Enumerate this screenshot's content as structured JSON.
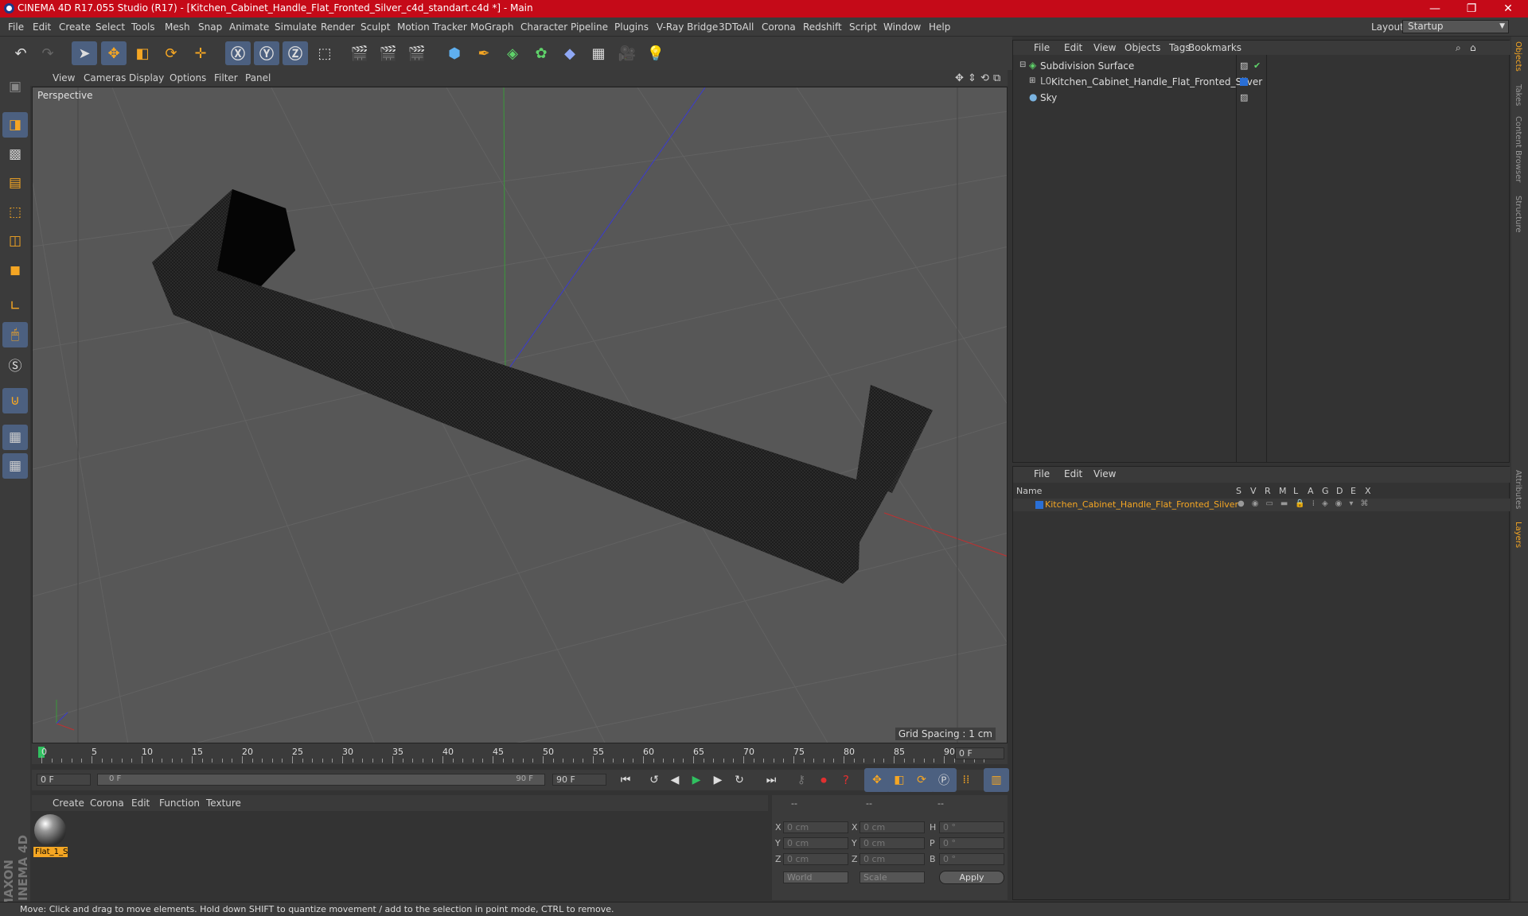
{
  "titlebar": {
    "title": "CINEMA 4D R17.055 Studio (R17) - [Kitchen_Cabinet_Handle_Flat_Fronted_Silver_c4d_standart.c4d *] - Main",
    "minimize": "—",
    "maximize": "❐",
    "close": "✕"
  },
  "menubar": {
    "items": [
      "File",
      "Edit",
      "Create",
      "Select",
      "Tools",
      "Mesh",
      "Snap",
      "Animate",
      "Simulate",
      "Render",
      "Sculpt",
      "Motion Tracker",
      "MoGraph",
      "Character",
      "Pipeline",
      "Plugins",
      "V-Ray Bridge",
      "3DToAll",
      "Corona",
      "Redshift",
      "Script",
      "Window",
      "Help"
    ],
    "layout_label": "Layout:",
    "layout_value": "Startup"
  },
  "viewport": {
    "menu": [
      "View",
      "Cameras",
      "Display",
      "Options",
      "Filter",
      "Panel"
    ],
    "label": "Perspective",
    "grid_spacing": "Grid Spacing : 1 cm"
  },
  "timeline": {
    "ticks": [
      "0",
      "5",
      "10",
      "15",
      "20",
      "25",
      "30",
      "35",
      "40",
      "45",
      "50",
      "55",
      "60",
      "65",
      "70",
      "75",
      "80",
      "85",
      "90"
    ],
    "current_frame": "0 F",
    "start_field": "0 F",
    "range_start": "0 F",
    "range_end": "90 F",
    "end_field": "90 F"
  },
  "material_manager": {
    "menu": [
      "Create",
      "Corona",
      "Edit",
      "Function",
      "Texture"
    ],
    "materials": [
      {
        "name": "Flat_1_S"
      }
    ]
  },
  "coordinates": {
    "headers": [
      "--",
      "--",
      "--"
    ],
    "rows": [
      {
        "a": "X",
        "av": "0 cm",
        "b": "X",
        "bv": "0 cm",
        "c": "H",
        "cv": "0 °"
      },
      {
        "a": "Y",
        "av": "0 cm",
        "b": "Y",
        "bv": "0 cm",
        "c": "P",
        "cv": "0 °"
      },
      {
        "a": "Z",
        "av": "0 cm",
        "b": "Z",
        "bv": "0 cm",
        "c": "B",
        "cv": "0 °"
      }
    ],
    "world": "World",
    "scale": "Scale",
    "apply": "Apply"
  },
  "object_manager": {
    "menu": [
      "File",
      "Edit",
      "View",
      "Objects",
      "Tags",
      "Bookmarks"
    ],
    "objects": [
      {
        "name": "Subdivision Surface"
      },
      {
        "name": "Kitchen_Cabinet_Handle_Flat_Fronted_Silver"
      },
      {
        "name": "Sky"
      }
    ]
  },
  "layer_manager": {
    "menu": [
      "File",
      "Edit",
      "View"
    ],
    "columns": [
      "Name",
      "S",
      "V",
      "R",
      "M",
      "L",
      "A",
      "G",
      "D",
      "E",
      "X"
    ],
    "layers": [
      {
        "name": "Kitchen_Cabinet_Handle_Flat_Fronted_Silver"
      }
    ]
  },
  "siderail": {
    "tabs": [
      "Objects",
      "Takes",
      "Content Browser",
      "Structure",
      "Attributes",
      "Layers"
    ]
  },
  "branding": "MAXON CINEMA 4D",
  "status": "Move: Click and drag to move elements. Hold down SHIFT to quantize movement / add to the selection in point mode, CTRL to remove.",
  "colors": {
    "titlebar": "#c50a18",
    "accent_orange": "#f5a623",
    "layer_blue": "#2a6fd6",
    "selection_blue": "#4c6080"
  }
}
